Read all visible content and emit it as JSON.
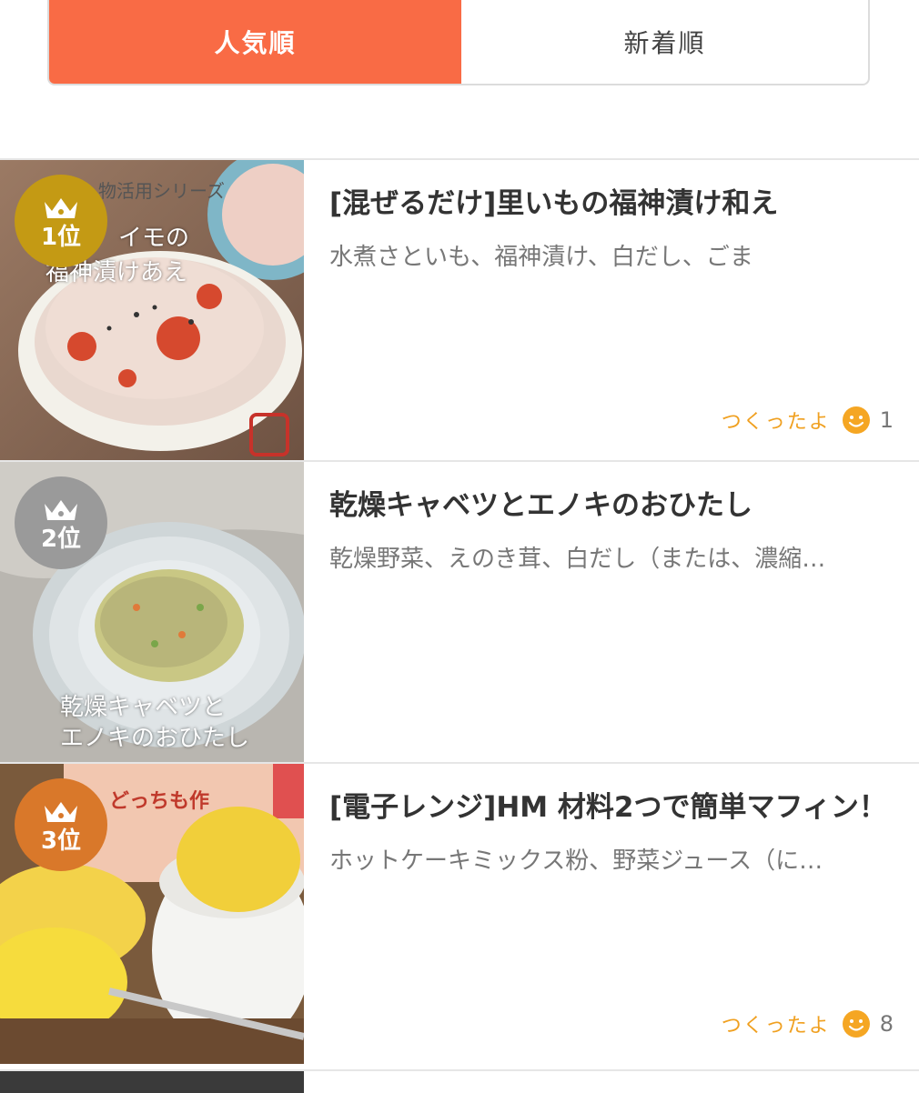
{
  "tabs": {
    "popular": "人気順",
    "newest": "新着順"
  },
  "recipes": [
    {
      "rank": "1位",
      "badge_color": "#c49a14",
      "title": "[混ぜるだけ]里いもの福神漬け和え",
      "ingredients": "水煮さといも、福神漬け、白だし、ごま",
      "tsukutta_label": "つくったよ",
      "tsukutta_count": "1",
      "photo_text_top": "物活用シリーズ",
      "photo_text_line1": "イモの",
      "photo_text_line2": "福神漬けあえ"
    },
    {
      "rank": "2位",
      "badge_color": "#9a9a9a",
      "title": "乾燥キャベツとエノキのおひたし",
      "ingredients": "乾燥野菜、えのき茸、白だし（または、濃縮…",
      "photo_text_line1": "乾燥キャベツと",
      "photo_text_line2": "エノキのおひたし"
    },
    {
      "rank": "3位",
      "badge_color": "#d9782a",
      "title": "[電子レンジ]HM 材料2つで簡単マフィン！",
      "ingredients": "ホットケーキミックス粉、野菜ジュース（に…",
      "tsukutta_label": "つくったよ",
      "tsukutta_count": "8",
      "photo_text_top": "どっちも作"
    }
  ],
  "colors": {
    "accent": "#f96b45",
    "tsukutta": "#f0a020",
    "smile": "#f5a623"
  }
}
